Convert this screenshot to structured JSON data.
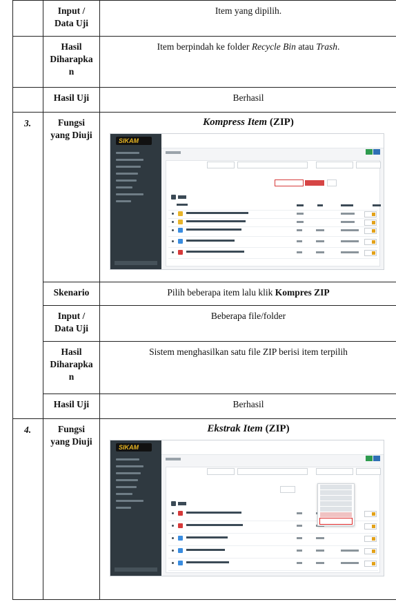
{
  "rows": {
    "input_label": "Input /\nData Uji",
    "input_value": "Item yang dipilih.",
    "expected_label": "Hasil\nDiharapka\nn",
    "expected_value_prefix": "Item berpindah ke folder ",
    "expected_value_em1": "Recycle Bin",
    "expected_value_mid": " atau ",
    "expected_value_em2": "Trash",
    "expected_value_suffix": ".",
    "result_label": "Hasil Uji",
    "result_value": "Berhasil"
  },
  "case3": {
    "number": "3.",
    "function_label": "Fungsi\nyang Diuji",
    "title_em": "Kompress Item",
    "title_rest": " (ZIP)",
    "scenario_label": "Skenario",
    "scenario_prefix": "Pilih beberapa item lalu klik ",
    "scenario_bold": "Kompres ZIP",
    "input_label": "Input /\nData Uji",
    "input_value": "Beberapa file/folder",
    "expected_label": "Hasil\nDiharapka\nn",
    "expected_value": "Sistem menghasilkan satu file ZIP berisi item terpilih",
    "result_label": "Hasil Uji",
    "result_value": "Berhasil"
  },
  "case4": {
    "number": "4.",
    "function_label": "Fungsi\nyang Diuji",
    "title_em": "Ekstrak Item",
    "title_rest": " (ZIP)"
  },
  "app": {
    "logo_text": "SIKAM",
    "logo_icon": "logo-icon",
    "colors": {
      "sidebar": "#2f3940",
      "accent_red": "#d63a3a",
      "green": "#2e9b4e",
      "blue": "#2f6fb5",
      "folder": "#e8b42a",
      "file_red": "#d63a3a",
      "file_blue": "#3a8de0"
    }
  }
}
